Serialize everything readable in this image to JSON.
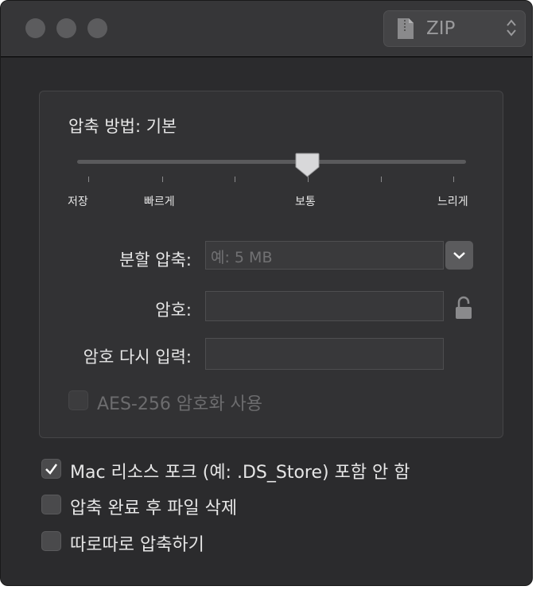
{
  "format": {
    "value": "ZIP",
    "icon": "zip-file-icon"
  },
  "compression": {
    "label": "압축 방법: 기본",
    "levels": [
      "저장",
      "빠르게",
      "보통",
      "느리게"
    ],
    "selected": "보통"
  },
  "split": {
    "label": "분할 압축:",
    "placeholder": "예: 5 MB"
  },
  "password": {
    "label": "암호:",
    "value": ""
  },
  "password_confirm": {
    "label": "암호 다시 입력:",
    "value": ""
  },
  "aes": {
    "label": "AES-256 암호화 사용",
    "checked": false,
    "enabled": false
  },
  "options": [
    {
      "label": "Mac 리소스 포크 (예: .DS_Store) 포함 안 함",
      "checked": true
    },
    {
      "label": "압축 완료 후 파일 삭제",
      "checked": false
    },
    {
      "label": "따로따로 압축하기",
      "checked": false
    }
  ]
}
